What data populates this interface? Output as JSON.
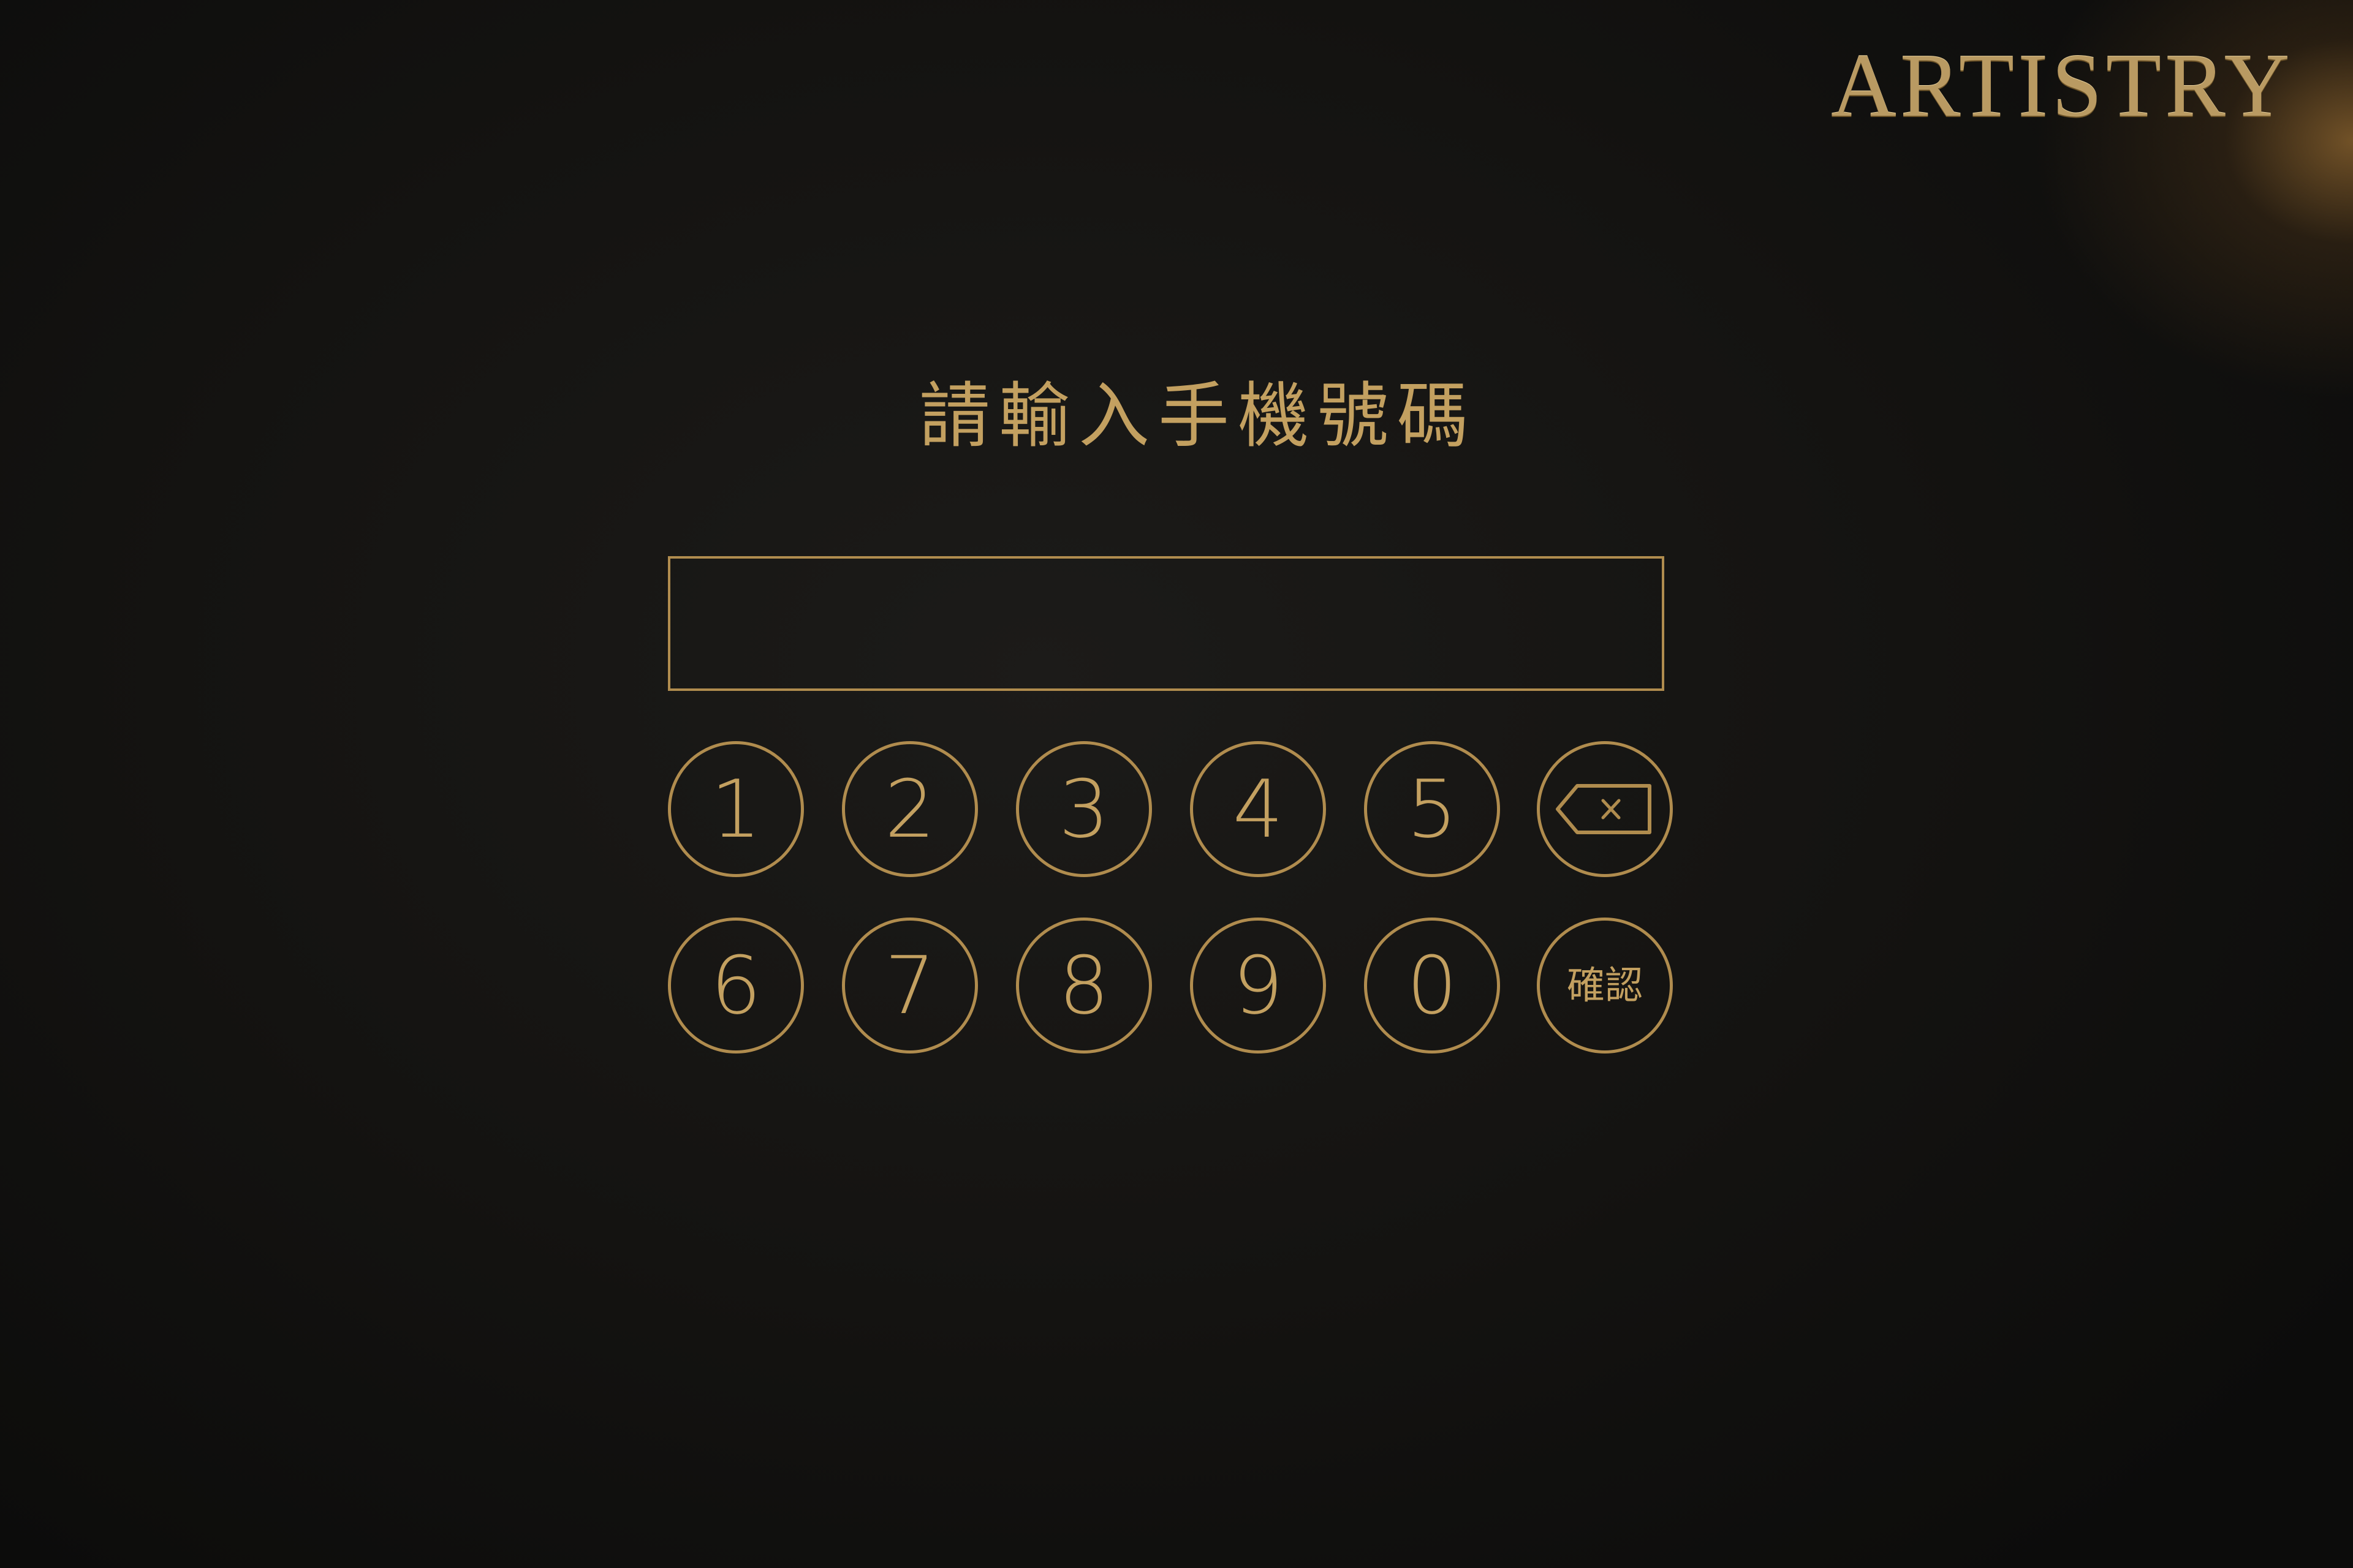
{
  "brand": {
    "logo_text": "ARTISTRY"
  },
  "prompt": {
    "title": "請輸入手機號碼"
  },
  "phone_input": {
    "value": "",
    "placeholder": ""
  },
  "keypad": {
    "row1": [
      "1",
      "2",
      "3",
      "4",
      "5"
    ],
    "row2": [
      "6",
      "7",
      "8",
      "9",
      "0"
    ],
    "backspace_icon": "backspace-icon",
    "confirm_label": "確認"
  },
  "colors": {
    "accent_gold": "#b08c4e",
    "text_gold": "#c3a060",
    "background": "#151412"
  }
}
